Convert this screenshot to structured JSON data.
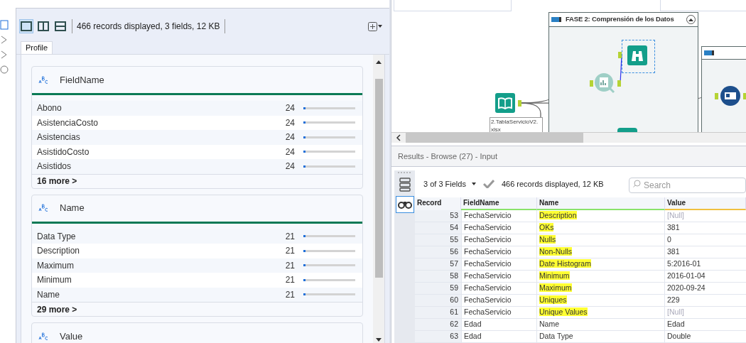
{
  "toolbar": {
    "layouts": [
      {
        "selected": true
      },
      {
        "selected": false
      },
      {
        "selected": false
      }
    ],
    "summary": "466 records displayed, 3 fields, 12 KB"
  },
  "tabs": [
    {
      "label": "Profile",
      "selected": true
    }
  ],
  "cards": [
    {
      "title": "FieldName",
      "rows": [
        {
          "label": "Abono",
          "count": "24",
          "level": 0.03
        },
        {
          "label": "AsistenciaCosto",
          "count": "24",
          "level": 0.03
        },
        {
          "label": "Asistencias",
          "count": "24",
          "level": 0.03
        },
        {
          "label": "AsistidoCosto",
          "count": "24",
          "level": 0.03
        },
        {
          "label": "Asistidos",
          "count": "24",
          "level": 0.03
        }
      ],
      "more": "16 more >"
    },
    {
      "title": "Name",
      "rows": [
        {
          "label": "Data Type",
          "count": "21",
          "level": 0.03
        },
        {
          "label": "Description",
          "count": "21",
          "level": 0.03
        },
        {
          "label": "Maximum",
          "count": "21",
          "level": 0.03
        },
        {
          "label": "Minimum",
          "count": "21",
          "level": 0.03
        },
        {
          "label": "Name",
          "count": "21",
          "level": 0.03
        }
      ],
      "more": "29 more >"
    },
    {
      "title": "Value"
    }
  ],
  "canvas": {
    "container": {
      "title": "FASE 2: Comprensión de los Datos",
      "expanded": true
    },
    "input_label": [
      "2.TablaServicioV2.",
      "xlsx"
    ]
  },
  "results": {
    "title": "Results - Browse (27) - Input",
    "fields_dropdown": "3 of 3 Fields",
    "summary": "466 records displayed, 12 KB",
    "search": {
      "placeholder": "Search"
    },
    "columns": [
      "Record",
      "FieldName",
      "Name",
      "Value"
    ],
    "rows": [
      {
        "record": "53",
        "fieldname": "FechaServicio",
        "name": "Description",
        "value": "[Null]",
        "highlighted": true,
        "null": true
      },
      {
        "record": "54",
        "fieldname": "FechaServicio",
        "name": "OKs",
        "value": "381",
        "highlighted": true,
        "null": false
      },
      {
        "record": "55",
        "fieldname": "FechaServicio",
        "name": "Nulls",
        "value": "0",
        "highlighted": true,
        "null": false
      },
      {
        "record": "56",
        "fieldname": "FechaServicio",
        "name": "Non-Nulls",
        "value": "381",
        "highlighted": true,
        "null": false
      },
      {
        "record": "57",
        "fieldname": "FechaServicio",
        "name": "Date Histogram",
        "value": "5:2016-01",
        "highlighted": true,
        "null": false
      },
      {
        "record": "58",
        "fieldname": "FechaServicio",
        "name": "Minimum",
        "value": "2016-01-04",
        "highlighted": true,
        "null": false
      },
      {
        "record": "59",
        "fieldname": "FechaServicio",
        "name": "Maximum",
        "value": "2020-09-24",
        "highlighted": true,
        "null": false
      },
      {
        "record": "60",
        "fieldname": "FechaServicio",
        "name": "Uniques",
        "value": "229",
        "highlighted": true,
        "null": false
      },
      {
        "record": "61",
        "fieldname": "FechaServicio",
        "name": "Unique Values",
        "value": "[Null]",
        "highlighted": true,
        "null": true
      },
      {
        "record": "62",
        "fieldname": "Edad",
        "name": "Name",
        "value": "Edad",
        "highlighted": false,
        "null": false
      },
      {
        "record": "63",
        "fieldname": "Edad",
        "name": "Data Type",
        "value": "Double",
        "highlighted": false,
        "null": false
      }
    ]
  }
}
